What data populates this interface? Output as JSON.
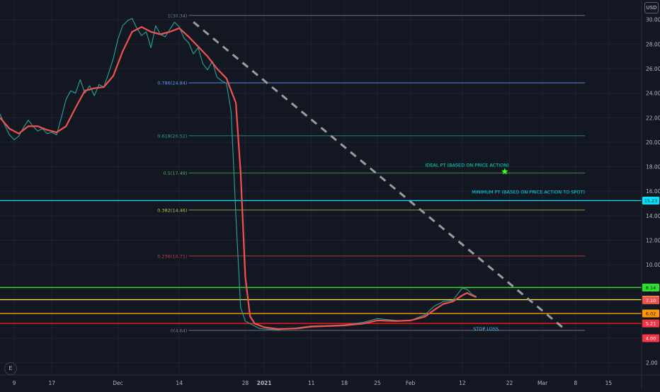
{
  "currency_badge": "USD",
  "logo_text": "E",
  "chart_data": {
    "type": "line",
    "title": "",
    "xlabel": "",
    "ylabel": "",
    "ylim": [
      1.0,
      31.6
    ],
    "x_range": [
      "2020-11-06",
      "2021-03-22"
    ],
    "y_axis_ticks": [
      2,
      4,
      6,
      8,
      10,
      12,
      14,
      16,
      18,
      20,
      22,
      24,
      26,
      28,
      30
    ],
    "x_axis_ticks": [
      {
        "label": "9",
        "date": "2020-11-09"
      },
      {
        "label": "17",
        "date": "2020-11-17"
      },
      {
        "label": "Dec",
        "date": "2020-12-01"
      },
      {
        "label": "14",
        "date": "2020-12-14"
      },
      {
        "label": "28",
        "date": "2020-12-28"
      },
      {
        "label": "2021",
        "date": "2021-01-01"
      },
      {
        "label": "11",
        "date": "2021-01-11"
      },
      {
        "label": "18",
        "date": "2021-01-18"
      },
      {
        "label": "25",
        "date": "2021-01-25"
      },
      {
        "label": "Feb",
        "date": "2021-02-01"
      },
      {
        "label": "12",
        "date": "2021-02-12"
      },
      {
        "label": "22",
        "date": "2021-02-22"
      },
      {
        "label": "Mar",
        "date": "2021-03-01"
      },
      {
        "label": "8",
        "date": "2021-03-08"
      },
      {
        "label": "15",
        "date": "2021-03-15"
      }
    ],
    "series": [
      {
        "color": "#26a69a",
        "x": [
          "2020-11-06",
          "2020-11-07",
          "2020-11-08",
          "2020-11-09",
          "2020-11-10",
          "2020-11-11",
          "2020-11-12",
          "2020-11-13",
          "2020-11-14",
          "2020-11-15",
          "2020-11-16",
          "2020-11-17",
          "2020-11-18",
          "2020-11-19",
          "2020-11-20",
          "2020-11-21",
          "2020-11-22",
          "2020-11-23",
          "2020-11-24",
          "2020-11-25",
          "2020-11-26",
          "2020-11-27",
          "2020-11-28",
          "2020-11-29",
          "2020-11-30",
          "2020-12-01",
          "2020-12-02",
          "2020-12-03",
          "2020-12-04",
          "2020-12-05",
          "2020-12-06",
          "2020-12-07",
          "2020-12-08",
          "2020-12-09",
          "2020-12-10",
          "2020-12-11",
          "2020-12-12",
          "2020-12-13",
          "2020-12-14",
          "2020-12-15",
          "2020-12-16",
          "2020-12-17",
          "2020-12-18",
          "2020-12-19",
          "2020-12-20",
          "2020-12-21",
          "2020-12-22",
          "2020-12-23",
          "2020-12-24",
          "2020-12-25",
          "2020-12-26",
          "2020-12-27",
          "2020-12-28",
          "2020-12-29",
          "2020-12-30",
          "2020-12-31",
          "2021-01-01",
          "2021-01-04",
          "2021-01-08",
          "2021-01-11",
          "2021-01-15",
          "2021-01-18",
          "2021-01-22",
          "2021-01-25",
          "2021-01-29",
          "2021-02-01",
          "2021-02-04",
          "2021-02-06",
          "2021-02-08",
          "2021-02-10",
          "2021-02-11",
          "2021-02-12",
          "2021-02-13",
          "2021-02-14",
          "2021-02-15"
        ],
        "values": [
          22.3,
          21.4,
          20.6,
          20.2,
          20.5,
          21.2,
          21.8,
          21.3,
          20.9,
          21.1,
          20.7,
          20.8,
          20.6,
          22.0,
          23.5,
          24.2,
          24.0,
          25.1,
          24.0,
          24.6,
          23.8,
          24.7,
          24.5,
          25.6,
          26.8,
          28.4,
          29.5,
          29.9,
          30.1,
          29.3,
          28.7,
          29.0,
          27.7,
          29.5,
          28.8,
          28.6,
          29.2,
          29.8,
          29.4,
          28.5,
          28.1,
          27.2,
          27.7,
          26.4,
          25.9,
          26.6,
          25.3,
          25.0,
          24.8,
          22.5,
          14.0,
          6.5,
          5.4,
          5.2,
          5.0,
          4.8,
          4.75,
          4.7,
          4.85,
          5.0,
          5.05,
          5.1,
          5.3,
          5.6,
          5.45,
          5.45,
          5.9,
          6.6,
          7.0,
          7.1,
          7.6,
          8.1,
          8.0,
          7.6,
          7.4
        ]
      },
      {
        "color": "#ef5350",
        "x": [
          "2020-11-06",
          "2020-11-08",
          "2020-11-10",
          "2020-11-12",
          "2020-11-14",
          "2020-11-16",
          "2020-11-18",
          "2020-11-20",
          "2020-11-22",
          "2020-11-24",
          "2020-11-26",
          "2020-11-28",
          "2020-11-30",
          "2020-12-02",
          "2020-12-04",
          "2020-12-06",
          "2020-12-08",
          "2020-12-10",
          "2020-12-12",
          "2020-12-14",
          "2020-12-16",
          "2020-12-18",
          "2020-12-20",
          "2020-12-22",
          "2020-12-24",
          "2020-12-26",
          "2020-12-27",
          "2020-12-28",
          "2020-12-29",
          "2020-12-30",
          "2021-01-01",
          "2021-01-04",
          "2021-01-08",
          "2021-01-11",
          "2021-01-15",
          "2021-01-18",
          "2021-01-22",
          "2021-01-25",
          "2021-01-29",
          "2021-02-01",
          "2021-02-04",
          "2021-02-06",
          "2021-02-08",
          "2021-02-10",
          "2021-02-12",
          "2021-02-13",
          "2021-02-14",
          "2021-02-15"
        ],
        "values": [
          22.0,
          21.1,
          20.7,
          21.3,
          21.3,
          21.0,
          20.8,
          21.3,
          22.8,
          24.2,
          24.4,
          24.5,
          25.4,
          27.4,
          29.0,
          29.4,
          29.0,
          28.8,
          29.0,
          29.3,
          28.6,
          27.8,
          27.0,
          26.0,
          25.2,
          23.2,
          17.5,
          9.0,
          5.8,
          5.2,
          4.9,
          4.75,
          4.8,
          4.95,
          5.0,
          5.05,
          5.2,
          5.45,
          5.4,
          5.45,
          5.75,
          6.3,
          6.8,
          7.0,
          7.5,
          7.7,
          7.5,
          7.35
        ]
      }
    ],
    "fib_levels": [
      {
        "label": "1(30.34)",
        "value": 30.34,
        "color": "#787b86"
      },
      {
        "label": "0.786(24.84)",
        "value": 24.84,
        "color": "#5b9cf6"
      },
      {
        "label": "0.618(20.52)",
        "value": 20.52,
        "color": "#26a69a"
      },
      {
        "label": "0.5(17.49)",
        "value": 17.49,
        "color": "#4caf50"
      },
      {
        "label": "0.382(14.46)",
        "value": 14.46,
        "color": "#b9c44a"
      },
      {
        "label": "0.236(10.71)",
        "value": 10.71,
        "color": "#c23d3d"
      },
      {
        "label": "0(4.64)",
        "value": 4.64,
        "color": "#787b86"
      }
    ],
    "horizontal_lines": [
      {
        "value": 15.23,
        "color": "#00e5ff",
        "badge": "15.23",
        "badge_color": "#00e5ff",
        "badge_text_color": "#131722"
      },
      {
        "value": 8.14,
        "color": "#2ee02e",
        "badge": "8.14",
        "badge_color": "#2ee02e",
        "badge_text_color": "#131722"
      },
      {
        "value": 7.15,
        "color": "#ffeb3b",
        "badge": "7.15",
        "badge_color": "#ffeb3b",
        "badge_text_color": "#131722"
      },
      {
        "value": 6.02,
        "color": "#ff9800",
        "badge": "6.02",
        "badge_color": "#ff9800",
        "badge_text_color": "#131722"
      },
      {
        "value": 5.21,
        "color": "#ff1a1a",
        "badge": "5.21",
        "badge_color": "#f23645",
        "badge_text_color": "#ffffff"
      }
    ],
    "extra_badges": [
      {
        "value": 7.11,
        "text": "7.11",
        "color": "#ef5350",
        "text_color": "#ffffff"
      },
      {
        "value": 7.1,
        "text": "7.10",
        "color": "#ef5350",
        "text_color": "#ffffff"
      },
      {
        "value": 4.0,
        "text": "4.00",
        "color": "#f23645",
        "text_color": "#ffffff"
      }
    ],
    "annotations": [
      {
        "text": "IDEAL PT (BASED ON PRICE ACTION)",
        "date": "2021-02-13",
        "value": 18.0,
        "color": "#00e5c8"
      },
      {
        "text": "MINIMUM PT (BASED ON PRICE ACTION TO SPOT)",
        "date": "2021-02-26",
        "value": 15.8,
        "color": "#00e5ff"
      },
      {
        "text": "STOP LOSS",
        "date": "2021-02-17",
        "value": 4.65,
        "color": "#4fc3f7"
      }
    ],
    "star_marker": {
      "date": "2021-02-21",
      "value": 17.6,
      "color": "#39ff14"
    },
    "trend_line": {
      "start": {
        "date": "2020-12-17",
        "value": 29.8
      },
      "end": {
        "date": "2021-03-06",
        "value": 4.65
      },
      "color": "#9b9b9b"
    }
  }
}
